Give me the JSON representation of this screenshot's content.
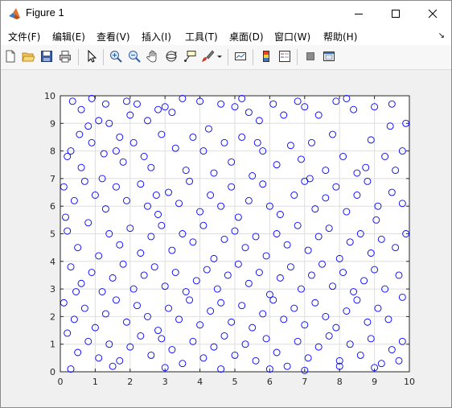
{
  "window": {
    "title": "Figure 1"
  },
  "menu": [
    "文件(F)",
    "编辑(E)",
    "查看(V)",
    "插入(I)",
    "工具(T)",
    "桌面(D)",
    "窗口(W)",
    "帮助(H)"
  ],
  "toolbar_icons": [
    "new-figure-icon",
    "open-file-icon",
    "save-icon",
    "print-icon",
    "select-arrow-icon",
    "zoom-in-icon",
    "zoom-out-icon",
    "pan-hand-icon",
    "rotate-3d-icon",
    "data-cursor-icon",
    "brush-icon",
    "brush-dropdown-icon",
    "link-plot-icon",
    "colorbar-icon",
    "legend-icon",
    "hide-plot-tools-icon",
    "show-plot-tools-icon"
  ],
  "chart_data": {
    "type": "scatter",
    "title": "",
    "xlabel": "",
    "ylabel": "",
    "xlim": [
      0,
      10
    ],
    "ylim": [
      0,
      10
    ],
    "xticks": [
      0,
      1,
      2,
      3,
      4,
      5,
      6,
      7,
      8,
      9,
      10
    ],
    "yticks": [
      0,
      1,
      2,
      3,
      4,
      5,
      6,
      7,
      8,
      9,
      10
    ],
    "grid": true,
    "marker": "circle-open",
    "marker_color": "#0000ff",
    "series": [
      {
        "points": [
          [
            0.35,
            9.8
          ],
          [
            0.9,
            9.9
          ],
          [
            1.3,
            9.7
          ],
          [
            1.4,
            9.0
          ],
          [
            0.8,
            8.9
          ],
          [
            1.1,
            9.1
          ],
          [
            1.7,
            8.5
          ],
          [
            2.0,
            9.3
          ],
          [
            2.2,
            9.7
          ],
          [
            2.5,
            9.1
          ],
          [
            2.8,
            9.5
          ],
          [
            3.0,
            9.6
          ],
          [
            3.2,
            9.4
          ],
          [
            4.0,
            9.8
          ],
          [
            4.6,
            9.7
          ],
          [
            5.0,
            9.6
          ],
          [
            5.4,
            9.4
          ],
          [
            5.7,
            9.1
          ],
          [
            6.1,
            9.7
          ],
          [
            6.4,
            9.3
          ],
          [
            7.0,
            9.6
          ],
          [
            7.4,
            9.3
          ],
          [
            7.9,
            9.8
          ],
          [
            8.4,
            9.5
          ],
          [
            9.0,
            9.6
          ],
          [
            9.9,
            9.0
          ],
          [
            0.2,
            7.8
          ],
          [
            0.3,
            8.0
          ],
          [
            0.6,
            7.4
          ],
          [
            0.9,
            8.3
          ],
          [
            1.2,
            7.0
          ],
          [
            1.6,
            8.0
          ],
          [
            1.8,
            7.6
          ],
          [
            2.1,
            8.3
          ],
          [
            2.4,
            7.8
          ],
          [
            2.6,
            7.4
          ],
          [
            2.9,
            8.6
          ],
          [
            3.3,
            8.1
          ],
          [
            3.6,
            7.3
          ],
          [
            3.8,
            8.5
          ],
          [
            4.1,
            8.0
          ],
          [
            4.4,
            7.2
          ],
          [
            4.7,
            8.3
          ],
          [
            4.9,
            7.6
          ],
          [
            5.2,
            8.5
          ],
          [
            5.5,
            7.1
          ],
          [
            5.8,
            8.0
          ],
          [
            6.2,
            7.5
          ],
          [
            6.6,
            8.2
          ],
          [
            6.9,
            7.7
          ],
          [
            7.2,
            8.3
          ],
          [
            7.6,
            7.3
          ],
          [
            7.8,
            8.6
          ],
          [
            8.1,
            7.8
          ],
          [
            8.5,
            7.2
          ],
          [
            8.9,
            8.4
          ],
          [
            9.3,
            7.8
          ],
          [
            9.6,
            7.3
          ],
          [
            9.8,
            8.0
          ],
          [
            0.1,
            6.7
          ],
          [
            0.4,
            6.2
          ],
          [
            0.7,
            6.9
          ],
          [
            1.0,
            6.4
          ],
          [
            1.3,
            5.9
          ],
          [
            1.6,
            6.7
          ],
          [
            1.9,
            6.2
          ],
          [
            2.3,
            6.8
          ],
          [
            2.5,
            6.0
          ],
          [
            2.8,
            5.7
          ],
          [
            3.1,
            6.5
          ],
          [
            3.4,
            6.1
          ],
          [
            3.7,
            6.9
          ],
          [
            4.0,
            5.8
          ],
          [
            4.3,
            6.4
          ],
          [
            4.6,
            6.0
          ],
          [
            4.9,
            6.7
          ],
          [
            5.1,
            5.6
          ],
          [
            5.4,
            6.2
          ],
          [
            5.8,
            6.8
          ],
          [
            6.0,
            6.0
          ],
          [
            6.3,
            5.7
          ],
          [
            6.7,
            6.4
          ],
          [
            7.0,
            6.9
          ],
          [
            7.3,
            5.9
          ],
          [
            7.6,
            6.3
          ],
          [
            7.9,
            6.7
          ],
          [
            8.2,
            5.8
          ],
          [
            8.5,
            6.4
          ],
          [
            8.8,
            6.9
          ],
          [
            9.1,
            6.0
          ],
          [
            9.5,
            6.5
          ],
          [
            9.8,
            6.1
          ],
          [
            0.2,
            5.1
          ],
          [
            0.5,
            4.5
          ],
          [
            0.8,
            5.4
          ],
          [
            1.1,
            4.2
          ],
          [
            1.4,
            5.0
          ],
          [
            1.7,
            4.6
          ],
          [
            2.0,
            5.2
          ],
          [
            2.3,
            4.3
          ],
          [
            2.6,
            4.9
          ],
          [
            2.9,
            5.3
          ],
          [
            3.2,
            4.4
          ],
          [
            3.5,
            5.0
          ],
          [
            3.8,
            4.7
          ],
          [
            4.1,
            5.3
          ],
          [
            4.4,
            4.1
          ],
          [
            4.7,
            4.8
          ],
          [
            5.0,
            5.1
          ],
          [
            5.3,
            4.5
          ],
          [
            5.6,
            4.9
          ],
          [
            5.9,
            4.2
          ],
          [
            6.2,
            5.0
          ],
          [
            6.5,
            4.6
          ],
          [
            6.8,
            5.3
          ],
          [
            7.1,
            4.4
          ],
          [
            7.4,
            4.9
          ],
          [
            7.7,
            5.2
          ],
          [
            8.0,
            4.1
          ],
          [
            8.3,
            4.7
          ],
          [
            8.6,
            5.0
          ],
          [
            8.9,
            4.3
          ],
          [
            9.2,
            4.8
          ],
          [
            9.6,
            4.5
          ],
          [
            9.9,
            5.0
          ],
          [
            0.3,
            3.8
          ],
          [
            0.6,
            3.2
          ],
          [
            0.9,
            3.6
          ],
          [
            1.2,
            2.9
          ],
          [
            1.5,
            3.4
          ],
          [
            1.8,
            3.9
          ],
          [
            2.1,
            3.0
          ],
          [
            2.4,
            3.5
          ],
          [
            2.7,
            3.8
          ],
          [
            3.0,
            3.1
          ],
          [
            3.3,
            3.6
          ],
          [
            3.6,
            2.9
          ],
          [
            3.9,
            3.3
          ],
          [
            4.2,
            3.7
          ],
          [
            4.5,
            3.0
          ],
          [
            4.8,
            3.5
          ],
          [
            5.1,
            3.9
          ],
          [
            5.4,
            3.2
          ],
          [
            5.7,
            3.6
          ],
          [
            6.0,
            2.8
          ],
          [
            6.3,
            3.4
          ],
          [
            6.6,
            3.8
          ],
          [
            6.9,
            3.0
          ],
          [
            7.2,
            3.5
          ],
          [
            7.5,
            3.9
          ],
          [
            7.8,
            3.1
          ],
          [
            8.1,
            3.6
          ],
          [
            8.4,
            2.9
          ],
          [
            8.7,
            3.3
          ],
          [
            9.0,
            3.7
          ],
          [
            9.3,
            3.0
          ],
          [
            9.7,
            3.5
          ],
          [
            0.1,
            2.5
          ],
          [
            0.4,
            1.9
          ],
          [
            0.7,
            2.3
          ],
          [
            1.0,
            1.6
          ],
          [
            1.3,
            2.1
          ],
          [
            1.6,
            2.6
          ],
          [
            1.9,
            1.8
          ],
          [
            2.2,
            2.4
          ],
          [
            2.5,
            2.0
          ],
          [
            2.8,
            1.5
          ],
          [
            3.1,
            2.3
          ],
          [
            3.4,
            1.9
          ],
          [
            3.7,
            2.6
          ],
          [
            4.0,
            1.7
          ],
          [
            4.3,
            2.2
          ],
          [
            4.6,
            2.5
          ],
          [
            4.9,
            1.8
          ],
          [
            5.2,
            2.4
          ],
          [
            5.5,
            1.6
          ],
          [
            5.8,
            2.1
          ],
          [
            6.1,
            2.6
          ],
          [
            6.4,
            1.9
          ],
          [
            6.7,
            2.3
          ],
          [
            7.0,
            1.7
          ],
          [
            7.3,
            2.5
          ],
          [
            7.6,
            2.0
          ],
          [
            7.9,
            1.6
          ],
          [
            8.2,
            2.2
          ],
          [
            8.5,
            2.6
          ],
          [
            8.8,
            1.8
          ],
          [
            9.1,
            2.3
          ],
          [
            9.4,
            1.9
          ],
          [
            9.8,
            2.7
          ],
          [
            0.2,
            1.4
          ],
          [
            0.5,
            0.7
          ],
          [
            0.8,
            1.1
          ],
          [
            1.1,
            0.5
          ],
          [
            1.4,
            1.0
          ],
          [
            1.7,
            0.4
          ],
          [
            2.0,
            0.9
          ],
          [
            2.3,
            1.3
          ],
          [
            2.6,
            0.6
          ],
          [
            2.9,
            1.2
          ],
          [
            3.2,
            0.8
          ],
          [
            3.5,
            0.3
          ],
          [
            3.8,
            1.1
          ],
          [
            4.1,
            0.5
          ],
          [
            4.4,
            0.9
          ],
          [
            4.7,
            1.3
          ],
          [
            5.0,
            0.6
          ],
          [
            5.3,
            1.0
          ],
          [
            5.6,
            0.4
          ],
          [
            5.9,
            1.2
          ],
          [
            6.2,
            0.7
          ],
          [
            6.5,
            0.2
          ],
          [
            6.8,
            1.1
          ],
          [
            7.1,
            0.5
          ],
          [
            7.4,
            0.9
          ],
          [
            7.7,
            1.3
          ],
          [
            8.0,
            0.4
          ],
          [
            8.3,
            1.0
          ],
          [
            8.6,
            0.6
          ],
          [
            8.9,
            1.2
          ],
          [
            9.2,
            0.3
          ],
          [
            9.5,
            0.8
          ],
          [
            9.8,
            1.1
          ],
          [
            0.3,
            0.1
          ],
          [
            1.5,
            0.2
          ],
          [
            3.0,
            0.15
          ],
          [
            4.6,
            0.1
          ],
          [
            6.0,
            0.1
          ],
          [
            7.0,
            0.05
          ],
          [
            8.0,
            0.2
          ],
          [
            9.0,
            0.15
          ],
          [
            9.7,
            0.4
          ],
          [
            0.6,
            9.5
          ],
          [
            1.9,
            9.8
          ],
          [
            3.5,
            9.9
          ],
          [
            5.2,
            9.9
          ],
          [
            6.8,
            9.8
          ],
          [
            8.2,
            9.9
          ],
          [
            9.5,
            9.7
          ],
          [
            0.15,
            5.6
          ],
          [
            0.55,
            8.6
          ],
          [
            1.25,
            7.9
          ],
          [
            2.75,
            6.4
          ],
          [
            4.25,
            8.8
          ],
          [
            5.65,
            8.3
          ],
          [
            7.15,
            7.0
          ],
          [
            8.75,
            7.4
          ],
          [
            9.45,
            8.9
          ],
          [
            9.05,
            5.5
          ],
          [
            0.45,
            2.9
          ]
        ]
      }
    ]
  }
}
